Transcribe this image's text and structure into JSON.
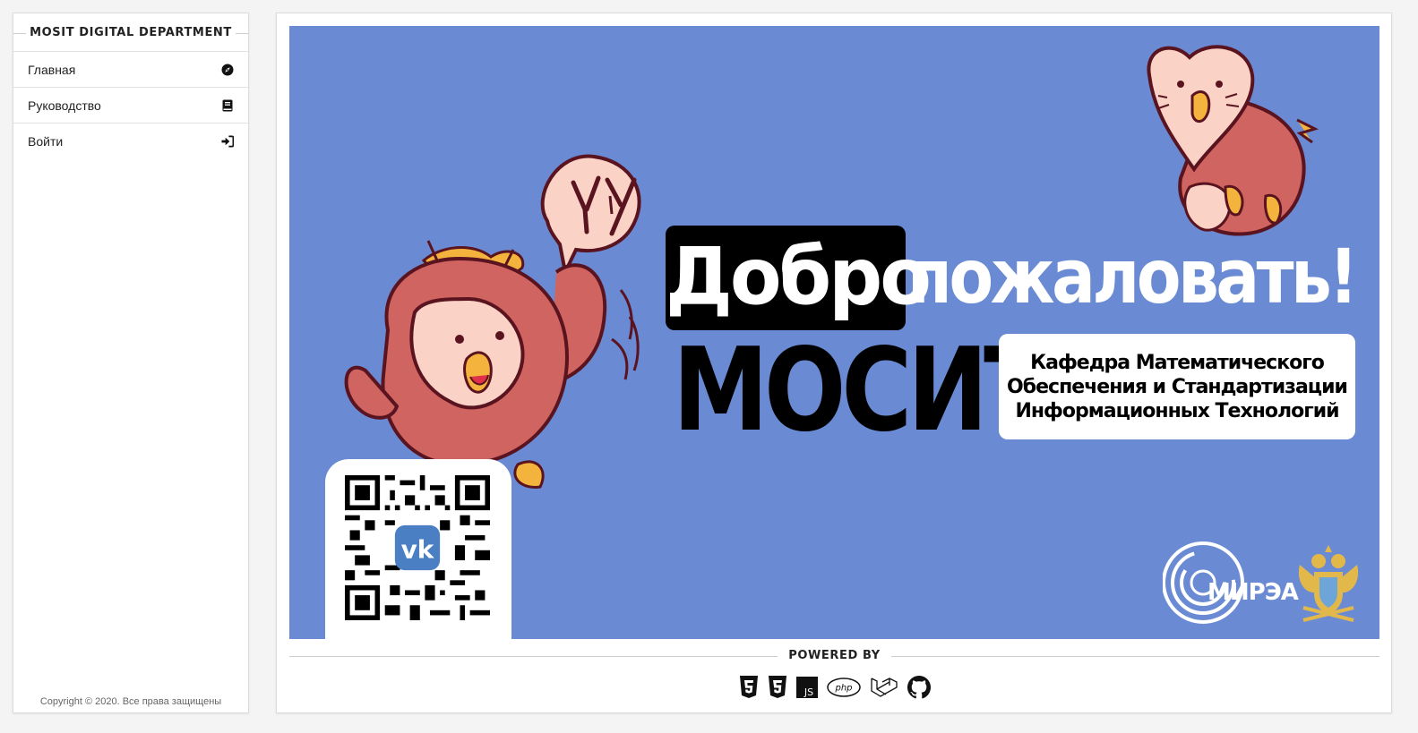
{
  "sidebar": {
    "title": "MOSIT DIGITAL DEPARTMENT",
    "items": [
      {
        "label": "Главная",
        "icon": "compass-icon"
      },
      {
        "label": "Руководство",
        "icon": "book-icon"
      },
      {
        "label": "Войти",
        "icon": "sign-in-icon"
      }
    ],
    "copyright": "Copyright © 2020. Все права защищены"
  },
  "banner": {
    "word_1": "Добро",
    "word_2": "пожаловать!",
    "word_3": "МОСИТ",
    "department_line_1": "Кафедра Математического",
    "department_line_2": "Обеспечения и Стандартизации",
    "department_line_3": "Информационных Технологий",
    "speech_text": "КУ",
    "logo_text": "МИРЭА",
    "background_color": "#6a8bd4"
  },
  "footer": {
    "powered_by": "POWERED BY",
    "tech_icons": [
      "html5-icon",
      "css3-icon",
      "js-icon",
      "php-icon",
      "laravel-icon",
      "github-icon"
    ]
  }
}
